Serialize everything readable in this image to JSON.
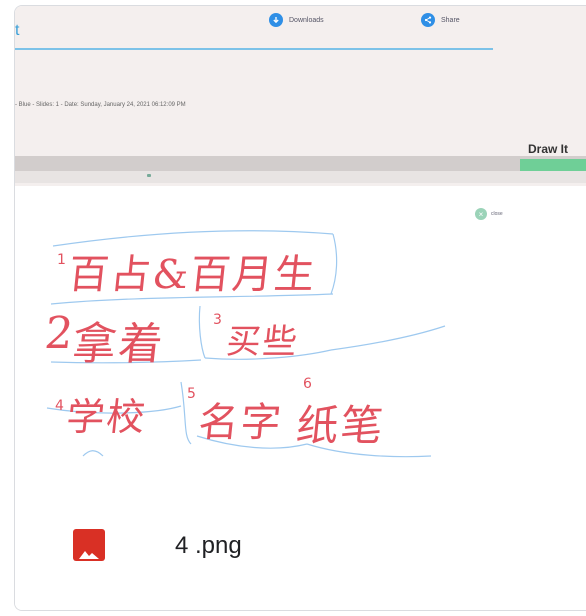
{
  "top": {
    "title_fragment": "t",
    "downloads_label": "Downloads",
    "share_label": "Share"
  },
  "meta_line": "- Blue - Slides: 1 - Date: Sunday, January 24, 2021 06:12:09 PM",
  "draw_button": "Draw It",
  "close_label": "close",
  "handwriting": {
    "row1_num": "1",
    "row1": "百占&百月生",
    "row2_num": "2",
    "row2": "拿着",
    "row2b_num": "3",
    "row2b": "买些",
    "row3_num": "4",
    "row3": "学校",
    "row3b_num": "5",
    "row3b": "名字",
    "row3c_num": "6",
    "row3c": "纸笔"
  },
  "file": {
    "name": "4 .png",
    "icon": "image-icon",
    "icon_color": "#d93025"
  },
  "colors": {
    "ink_red": "#e2525f",
    "ink_blue": "#7ab7e6",
    "accent_green": "#6fcf97"
  }
}
